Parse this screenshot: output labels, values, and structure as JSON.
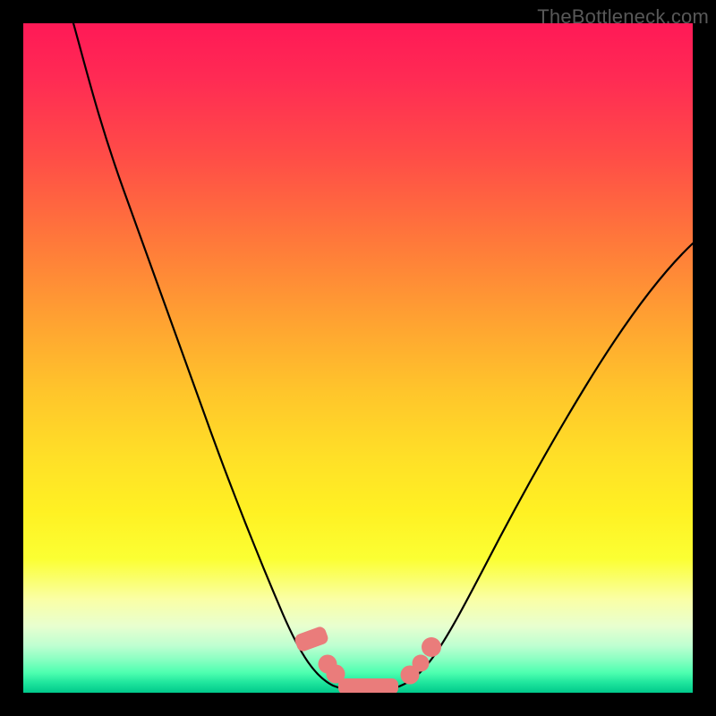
{
  "watermark": "TheBottleneck.com",
  "chart_data": {
    "type": "line",
    "title": "",
    "xlabel": "",
    "ylabel": "",
    "xlim_pct": [
      0,
      100
    ],
    "ylim_pct": [
      0,
      100
    ],
    "note": "V-shaped bottleneck curve over a red-to-green vertical gradient. Y axis approximates bottleneck % (top=high, bottom=0). X axis represents configuration sweep. No numeric axes shown; values below are read off pixel positions as percentages of the plot area.",
    "series": [
      {
        "name": "bottleneck-curve",
        "points_pct": [
          {
            "x": 7.5,
            "y": 100
          },
          {
            "x": 11,
            "y": 91
          },
          {
            "x": 15,
            "y": 80.5
          },
          {
            "x": 19,
            "y": 70
          },
          {
            "x": 23,
            "y": 59
          },
          {
            "x": 27,
            "y": 48
          },
          {
            "x": 31,
            "y": 37.5
          },
          {
            "x": 35,
            "y": 27
          },
          {
            "x": 39,
            "y": 17
          },
          {
            "x": 42.5,
            "y": 9
          },
          {
            "x": 45,
            "y": 4.2
          },
          {
            "x": 47.5,
            "y": 1.5
          },
          {
            "x": 50,
            "y": 0.5
          },
          {
            "x": 53,
            "y": 0.4
          },
          {
            "x": 56,
            "y": 0.8
          },
          {
            "x": 58.5,
            "y": 2.2
          },
          {
            "x": 61,
            "y": 5.2
          },
          {
            "x": 64,
            "y": 10
          },
          {
            "x": 68,
            "y": 17.5
          },
          {
            "x": 73,
            "y": 27
          },
          {
            "x": 79,
            "y": 38
          },
          {
            "x": 86,
            "y": 49.5
          },
          {
            "x": 93,
            "y": 59
          },
          {
            "x": 100,
            "y": 67
          }
        ]
      }
    ],
    "markers_pct": [
      {
        "shape": "pill",
        "x": 43.1,
        "y": 8.0,
        "w": 2.6,
        "h": 4.8,
        "angle": 70
      },
      {
        "shape": "circle",
        "x": 45.4,
        "y": 4.2,
        "r": 1.4
      },
      {
        "shape": "circle",
        "x": 46.6,
        "y": 2.7,
        "r": 1.4
      },
      {
        "shape": "pill",
        "x": 51.5,
        "y": 0.9,
        "w": 9.0,
        "h": 2.4,
        "angle": 0
      },
      {
        "shape": "circle",
        "x": 57.8,
        "y": 2.6,
        "r": 1.4
      },
      {
        "shape": "circle",
        "x": 59.4,
        "y": 4.3,
        "r": 1.3
      },
      {
        "shape": "circle",
        "x": 61.0,
        "y": 6.7,
        "r": 1.5
      }
    ]
  }
}
